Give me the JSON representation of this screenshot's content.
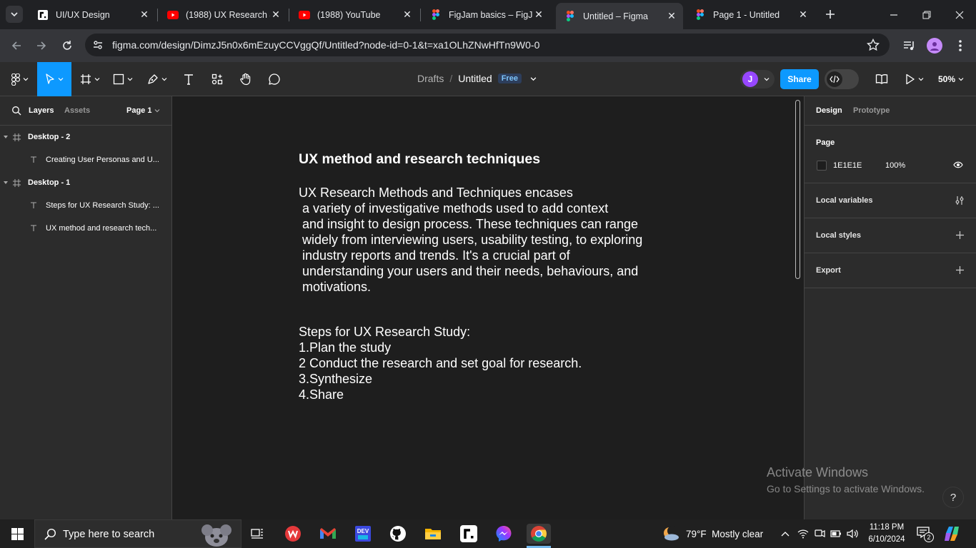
{
  "browser": {
    "tabs": [
      {
        "title": "UI/UX Design",
        "icon": "roadmap-icon"
      },
      {
        "title": "(1988) UX Research &",
        "icon": "youtube-icon"
      },
      {
        "title": "(1988) YouTube",
        "icon": "youtube-icon"
      },
      {
        "title": "FigJam basics – FigJa",
        "icon": "figma-icon"
      },
      {
        "title": "Untitled – Figma",
        "icon": "figma-icon",
        "active": true
      },
      {
        "title": "Page 1 - Untitled",
        "icon": "figma-icon"
      }
    ],
    "url": "figma.com/design/DimzJ5n0x6mEzuyCCVggQf/Untitled?node-id=0-1&t=xa1OLhZNwHfTn9W0-0"
  },
  "toolbar": {
    "breadcrumb_root": "Drafts",
    "breadcrumb_sep": "/",
    "file_name": "Untitled",
    "plan_badge": "Free",
    "avatar_letter": "J",
    "share_label": "Share",
    "zoom": "50%"
  },
  "left_panel": {
    "tabs": {
      "layers": "Layers",
      "assets": "Assets"
    },
    "page_selector": "Page 1",
    "layers": [
      {
        "name": "Desktop - 2",
        "type": "frame"
      },
      {
        "name": "Creating User Personas and U...",
        "type": "text"
      },
      {
        "name": "Desktop - 1",
        "type": "frame"
      },
      {
        "name": "Steps for UX Research Study: ...",
        "type": "text"
      },
      {
        "name": "UX method and research tech...",
        "type": "text"
      }
    ]
  },
  "right_panel": {
    "tabs": {
      "design": "Design",
      "prototype": "Prototype"
    },
    "page_label": "Page",
    "page_color_hex": "1E1E1E",
    "page_opacity": "100%",
    "sections": [
      "Local variables",
      "Local styles",
      "Export"
    ]
  },
  "canvas": {
    "heading": "UX method and research techniques",
    "paragraph_lines": [
      "UX Research Methods and Techniques encases",
      " a variety of investigative methods used to add context",
      " and insight to design process. These techniques can range",
      " widely from interviewing users, usability testing, to exploring",
      " industry reports and trends. It's a crucial part of",
      " understanding your users and their needs, behaviours, and",
      " motivations."
    ],
    "steps_lines": [
      "Steps for UX Research Study:",
      "1.Plan the study",
      "2 Conduct the research and set goal for research.",
      "3.Synthesize",
      "4.Share"
    ]
  },
  "watermark": {
    "title": "Activate Windows",
    "subtitle": "Go to Settings to activate Windows."
  },
  "help_label": "?",
  "taskbar": {
    "search_placeholder": "Type here to search",
    "weather": "79°F  Mostly clear",
    "time": "11:18 PM",
    "date": "6/10/2024",
    "notification_count": "2"
  },
  "colors": {
    "accent": "#0d99ff",
    "share_button": "#0d99ff",
    "avatar": "#9747ff",
    "free_badge_bg": "#2d3e5c",
    "free_badge_text": "#7cc4fa"
  }
}
